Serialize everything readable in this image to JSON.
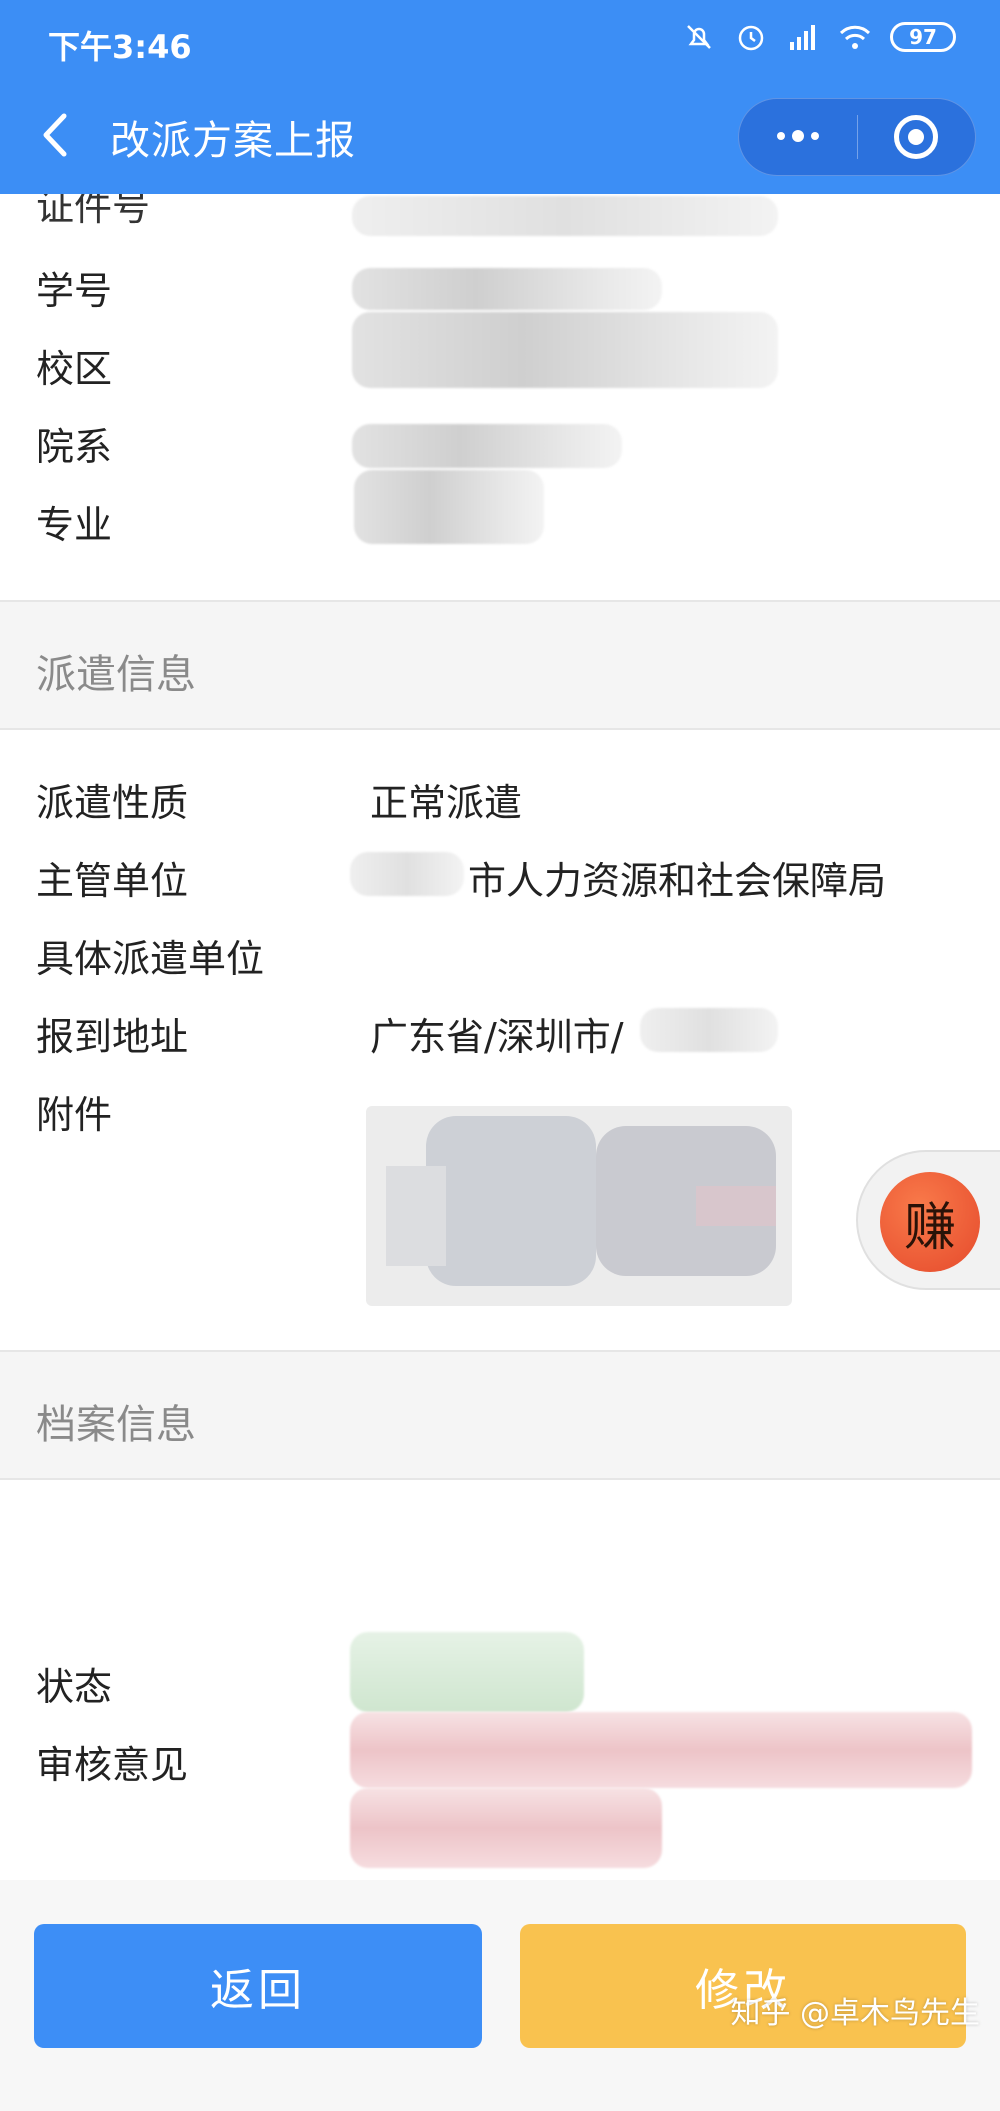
{
  "status_bar": {
    "time": "下午3:46",
    "battery": "97"
  },
  "header": {
    "title": "改派方案上报"
  },
  "student_info": {
    "cut_label": "证件号",
    "rows": [
      {
        "label": "学号"
      },
      {
        "label": "校区"
      },
      {
        "label": "院系"
      },
      {
        "label": "专业"
      }
    ]
  },
  "dispatch_section": {
    "title": "派遣信息",
    "nature_label": "派遣性质",
    "nature_value": "正常派遣",
    "authority_label": "主管单位",
    "authority_value": "市人力资源和社会保障局",
    "unit_label": "具体派遣单位",
    "unit_value": "",
    "address_label": "报到地址",
    "address_value": "广东省/深圳市/",
    "attachment_label": "附件"
  },
  "archive_section": {
    "title": "档案信息",
    "status_label": "状态",
    "review_label": "审核意见"
  },
  "floating": {
    "earn_label": "赚"
  },
  "buttons": {
    "back": "返回",
    "edit": "修改"
  },
  "watermark": "知乎 @卓木鸟先生",
  "colors": {
    "primary": "#3c8ef5",
    "accent": "#f9c24f"
  }
}
